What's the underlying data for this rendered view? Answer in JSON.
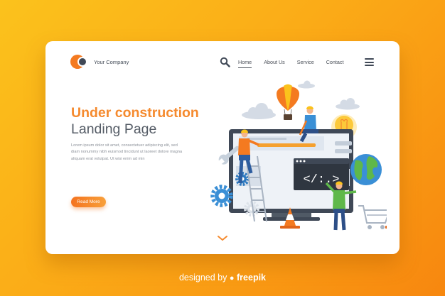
{
  "brand": {
    "name": "Your Company"
  },
  "nav": {
    "items": [
      {
        "label": "Home",
        "active": true
      },
      {
        "label": "About Us"
      },
      {
        "label": "Service"
      },
      {
        "label": "Contact"
      }
    ]
  },
  "hero": {
    "title": "Under construction",
    "subtitle": "Landing Page",
    "paragraph": "Lorem ipsum dolor sit amet, consectetuer adipiscing elit, sed diam nonummy nibh euismod tincidunt ut laoreet dolore magna aliquam erat volutpat. Ut wisi enim ad min",
    "cta": "Read More"
  },
  "illustration": {
    "code_symbol": "</:.>"
  },
  "credit": {
    "prefix": "designed by",
    "brand": "freepik"
  },
  "colors": {
    "accent": "#f58a2e",
    "background_from": "#fbc21c",
    "background_to": "#f7870f",
    "dark": "#3f4856"
  }
}
